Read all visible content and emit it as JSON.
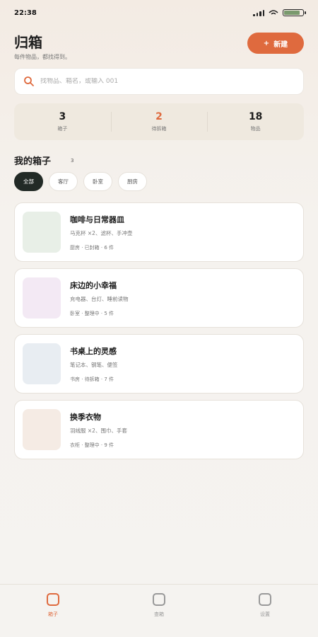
{
  "status_bar": {
    "time": "22:38",
    "battery_level": 0.85
  },
  "header": {
    "title": "归箱",
    "subtitle": "每件物品，都找得到。",
    "new_button_icon": "+",
    "new_button_label": "新建"
  },
  "search": {
    "placeholder": "找物品、箱名，或输入 001"
  },
  "stats": [
    {
      "value": "3",
      "label": "箱子"
    },
    {
      "value": "2",
      "label": "待拆箱"
    },
    {
      "value": "18",
      "label": "物品"
    }
  ],
  "section": {
    "title": "我的箱子",
    "count": "3"
  },
  "filters": [
    "全部",
    "客厅",
    "卧室",
    "厨房"
  ],
  "boxes": [
    {
      "title": "咖啡与日常器皿",
      "items": "马克杯 ×2、滤杯、手冲壶",
      "meta": "厨房 · 已封箱 · 6 件",
      "thumb_color": "#e8efe7"
    },
    {
      "title": "床边的小幸福",
      "items": "充电器、台灯、睡前读物",
      "meta": "卧室 · 整理中 · 5 件",
      "thumb_color": "#f3e9f4"
    },
    {
      "title": "书桌上的灵感",
      "items": "笔记本、钢笔、便签",
      "meta": "书房 · 待拆箱 · 7 件",
      "thumb_color": "#e8edf2"
    },
    {
      "title": "换季衣物",
      "items": "羽绒服 ×2、围巾、手套",
      "meta": "衣柜 · 整理中 · 9 件",
      "thumb_color": "#f5ebe4"
    }
  ],
  "tabs": [
    {
      "label": "箱子",
      "active": true
    },
    {
      "label": "查箱",
      "active": false
    },
    {
      "label": "设置",
      "active": false
    }
  ],
  "colors": {
    "accent": "#df6a3e",
    "dark": "#222a26"
  }
}
